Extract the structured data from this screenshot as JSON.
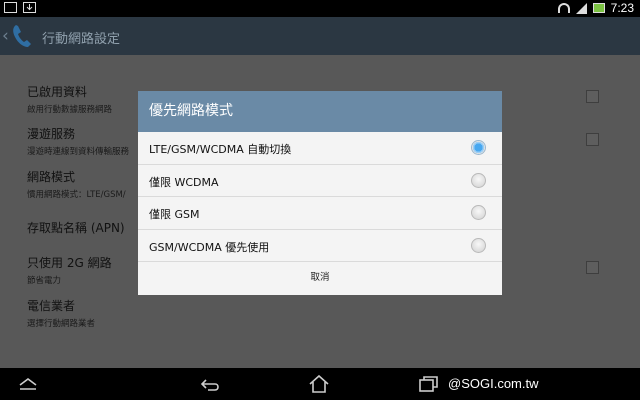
{
  "status_bar": {
    "time": "7:23"
  },
  "action_bar": {
    "title": "行動網路設定"
  },
  "settings": {
    "items": [
      {
        "title": "已啟用資料",
        "subtitle": "啟用行動數據服務網路"
      },
      {
        "title": "漫遊服務",
        "subtitle": "漫遊時連線到資料傳輸服務"
      },
      {
        "title": "網路模式",
        "subtitle": "慣用網路模式：LTE/GSM/"
      },
      {
        "title": "存取點名稱 (APN)",
        "subtitle": ""
      },
      {
        "title": "只使用 2G 網路",
        "subtitle": "節省電力"
      },
      {
        "title": "電信業者",
        "subtitle": "選擇行動網路業者"
      }
    ]
  },
  "dialog": {
    "title": "優先網路模式",
    "options": [
      {
        "label": "LTE/GSM/WCDMA 自動切換",
        "selected": true
      },
      {
        "label": "僅限 WCDMA",
        "selected": false
      },
      {
        "label": "僅限 GSM",
        "selected": false
      },
      {
        "label": "GSM/WCDMA 優先使用",
        "selected": false
      }
    ],
    "cancel_label": "取消"
  },
  "watermark": "@SOGI.com.tw",
  "colors": {
    "dialog_header": "#6a8aa6",
    "radio_selected": "#48a8f0",
    "action_bar": "#2b3742"
  }
}
